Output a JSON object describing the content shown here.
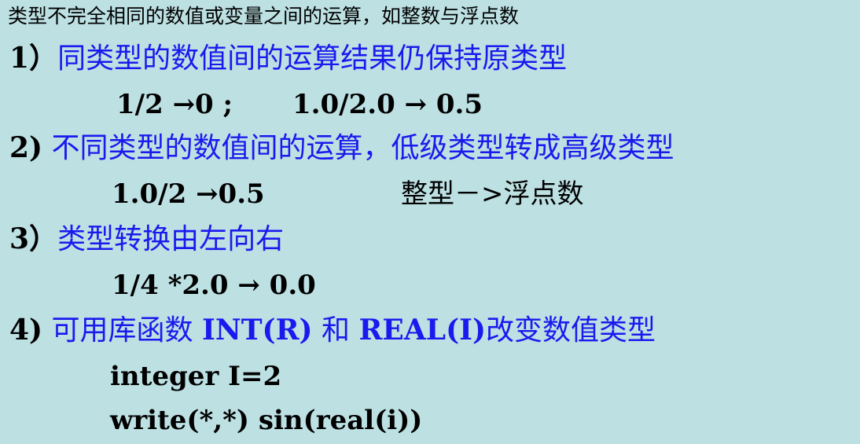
{
  "intro": "类型不完全相同的数值或变量之间的运算，如整数与浮点数",
  "rule1": {
    "num": "1）",
    "text": "同类型的数值间的运算结果仍保持原类型",
    "example_a": "1/2 →0 ;",
    "example_b": "1.0/2.0 → 0.5"
  },
  "rule2": {
    "num": "2)",
    "text": "不同类型的数值间的运算，低级类型转成高级类型",
    "example_a": "1.0/2 →0.5",
    "note": "整型－>浮点数"
  },
  "rule3": {
    "num": "3）",
    "text": "类型转换由左向右",
    "example_a": "1/4 *2.0 → 0.0"
  },
  "rule4": {
    "num": "4)",
    "text_pre": "可用库函数",
    "fn1": "INT(R)",
    "text_mid": "和",
    "fn2": "REAL(I)",
    "text_post": "改变数值类型",
    "code_line1": "integer I=2",
    "code_line2": "write(*,*) sin(real(i))"
  },
  "colors": {
    "background": "#bde0e3",
    "accent_blue": "#1a1aee",
    "text": "#000000"
  }
}
